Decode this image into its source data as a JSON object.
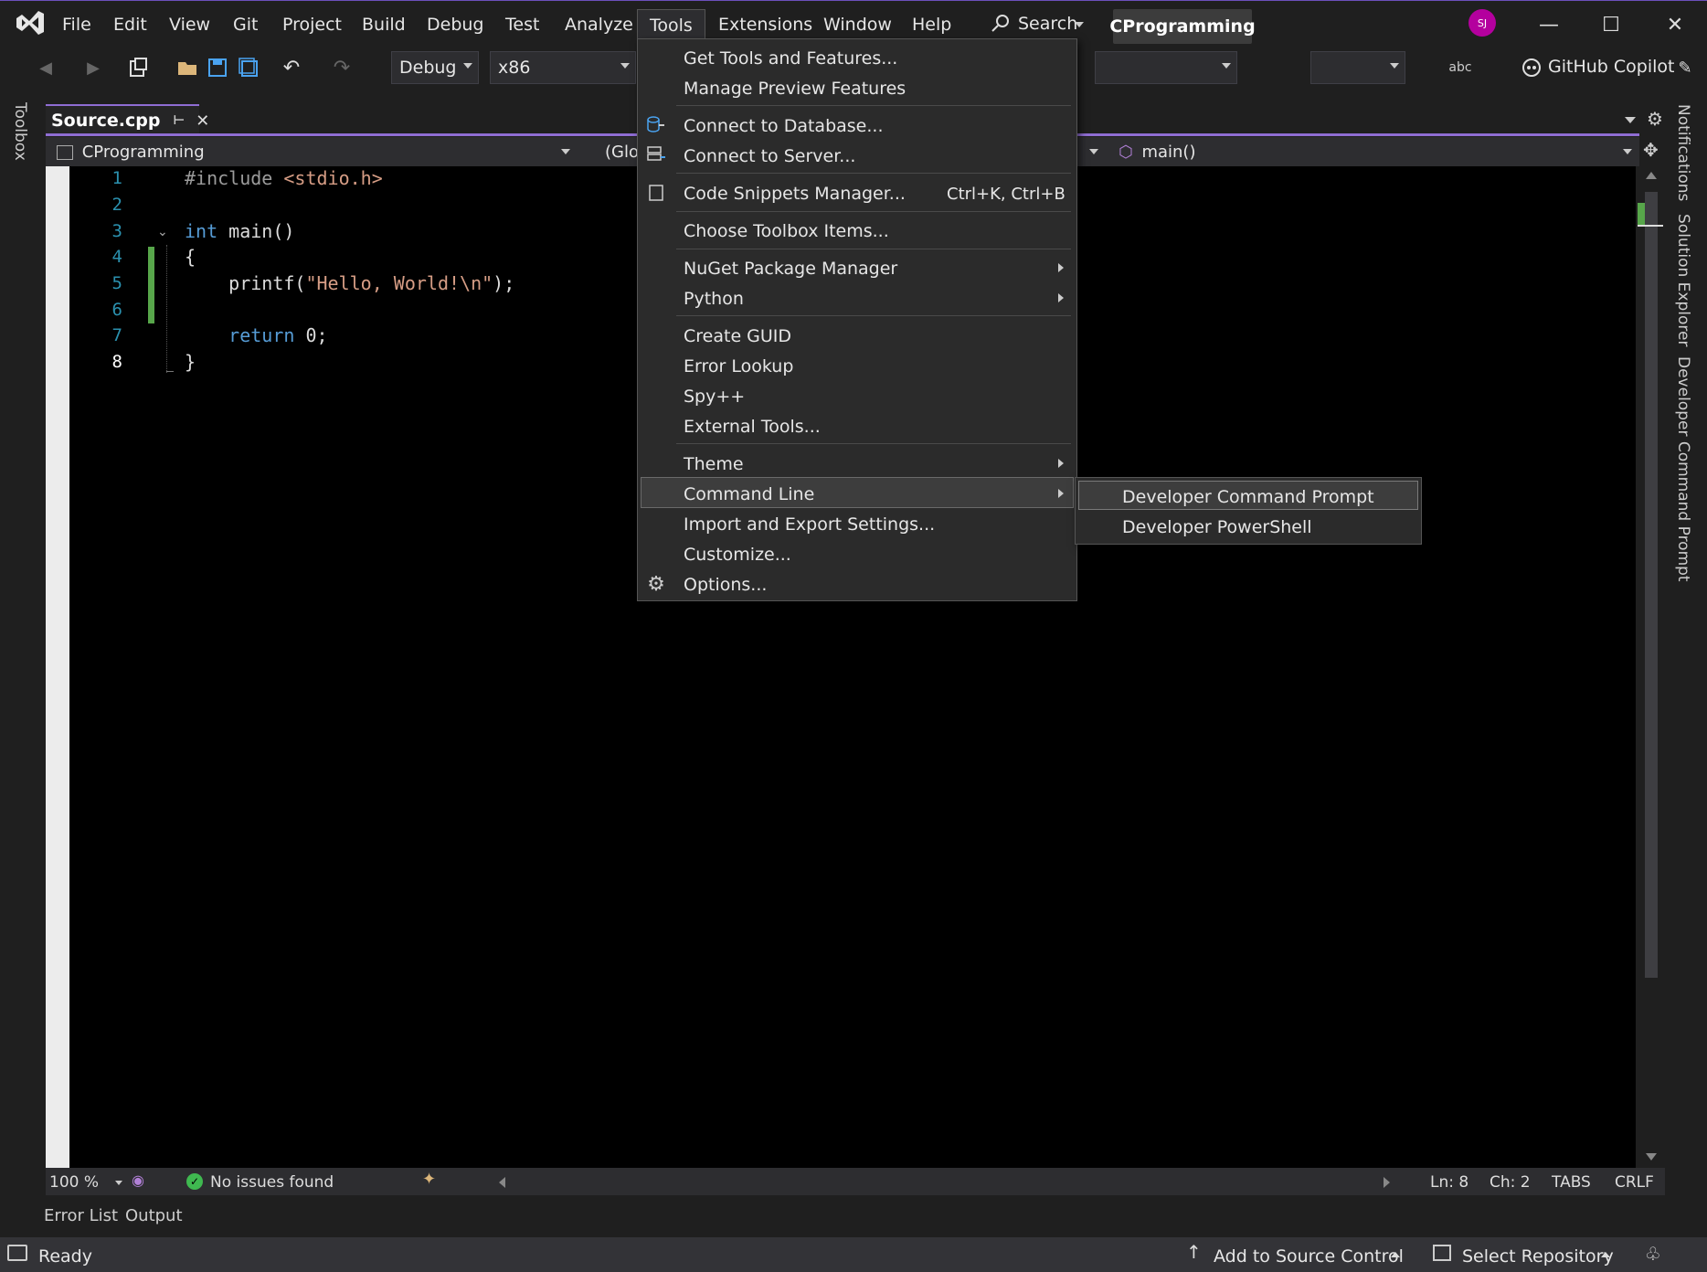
{
  "menubar": {
    "items": [
      "File",
      "Edit",
      "View",
      "Git",
      "Project",
      "Build",
      "Debug",
      "Test",
      "Analyze",
      "Tools",
      "Extensions",
      "Window",
      "Help"
    ],
    "search_label": "Search",
    "solution_name": "CProgramming",
    "avatar_initials": "SJ"
  },
  "toolbar": {
    "configuration": "Debug",
    "platform": "x86",
    "copilot_label": "GitHub Copilot"
  },
  "side_tabs": {
    "left": "Toolbox",
    "right": [
      "Notifications",
      "Solution Explorer",
      "Developer Command Prompt"
    ]
  },
  "document": {
    "tab_title": "Source.cpp",
    "project_combo": "CProgramming",
    "scope_combo": "(Glo",
    "member_combo": "main()"
  },
  "code": {
    "line_numbers": [
      "1",
      "2",
      "3",
      "4",
      "5",
      "6",
      "7",
      "8"
    ],
    "lines": [
      {
        "pp": "#include",
        "rest": " <stdio.h>"
      },
      {
        "text": ""
      },
      {
        "kw": "int",
        "rest": " main()"
      },
      {
        "text": "{"
      },
      {
        "pre": "    printf(",
        "str": "\"Hello, World!\\n\"",
        "post": ");"
      },
      {
        "text": ""
      },
      {
        "kw": "    return",
        "rest": " 0;"
      },
      {
        "text": "}"
      }
    ]
  },
  "editor_status": {
    "zoom": "100 %",
    "issues": "No issues found",
    "line": "Ln: 8",
    "char": "Ch: 2",
    "tabs": "TABS",
    "eol": "CRLF"
  },
  "bottom_tabs": [
    "Error List",
    "Output"
  ],
  "statusbar": {
    "state": "Ready",
    "source_control": "Add to Source Control",
    "repository": "Select Repository"
  },
  "tools_menu": {
    "items": [
      {
        "label": "Get Tools and Features..."
      },
      {
        "label": "Manage Preview Features"
      },
      {
        "label": "Connect to Database..."
      },
      {
        "label": "Connect to Server..."
      },
      {
        "label": "Code Snippets Manager...",
        "shortcut": "Ctrl+K, Ctrl+B"
      },
      {
        "label": "Choose Toolbox Items..."
      },
      {
        "label": "NuGet Package Manager"
      },
      {
        "label": "Python"
      },
      {
        "label": "Create GUID"
      },
      {
        "label": "Error Lookup"
      },
      {
        "label": "Spy++"
      },
      {
        "label": "External Tools..."
      },
      {
        "label": "Theme"
      },
      {
        "label": "Command Line"
      },
      {
        "label": "Import and Export Settings..."
      },
      {
        "label": "Customize..."
      },
      {
        "label": "Options..."
      }
    ]
  },
  "command_line_submenu": {
    "items": [
      "Developer Command Prompt",
      "Developer PowerShell"
    ]
  },
  "colors": {
    "accent": "#8f6dd3",
    "avatar": "#b4009e",
    "change_bar": "#57a64a"
  }
}
